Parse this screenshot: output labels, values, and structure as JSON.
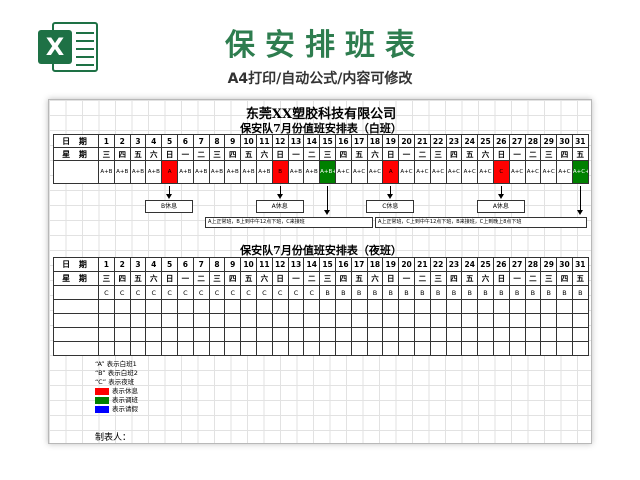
{
  "banner": {
    "title": "保安排班表",
    "subtitle": "A4打印/自动公式/内容可修改",
    "logo_icon": "excel-icon",
    "logo_letter": "X"
  },
  "sheet": {
    "company": "东莞XX塑胶科技有限公司",
    "day_title": "保安队7月份值班安排表（白班）",
    "night_title": "保安队7月份值班安排表（夜班）",
    "date_label": "日 期",
    "week_label": "星 期",
    "days": [
      "1",
      "2",
      "3",
      "4",
      "5",
      "6",
      "7",
      "8",
      "9",
      "10",
      "11",
      "12",
      "13",
      "14",
      "15",
      "16",
      "17",
      "18",
      "19",
      "20",
      "21",
      "22",
      "23",
      "24",
      "25",
      "26",
      "27",
      "28",
      "29",
      "30",
      "31"
    ],
    "weekdays": [
      "三",
      "四",
      "五",
      "六",
      "日",
      "一",
      "二",
      "三",
      "四",
      "五",
      "六",
      "日",
      "一",
      "二",
      "三",
      "四",
      "五",
      "六",
      "日",
      "一",
      "二",
      "三",
      "四",
      "五",
      "六",
      "日",
      "一",
      "二",
      "三",
      "四",
      "五"
    ],
    "day_shifts": [
      "A+B",
      "A+B",
      "A+B",
      "A+B",
      "A",
      "A+B",
      "A+B",
      "A+B",
      "A+B",
      "A+B",
      "A+B",
      "B",
      "A+B",
      "A+B",
      "A+B+C",
      "A+C",
      "A+C",
      "A+C",
      "A",
      "A+C",
      "A+C",
      "A+C",
      "A+C",
      "A+C",
      "A+C",
      "C",
      "A+C",
      "A+C",
      "A+C",
      "A+C",
      "A+C+B"
    ],
    "night_shifts": [
      "C",
      "C",
      "C",
      "C",
      "C",
      "C",
      "C",
      "C",
      "C",
      "C",
      "C",
      "C",
      "C",
      "C",
      "B",
      "B",
      "B",
      "B",
      "B",
      "B",
      "B",
      "B",
      "B",
      "B",
      "B",
      "B",
      "B",
      "B",
      "B",
      "B",
      "B"
    ],
    "rest_labels": [
      "B休息",
      "A休息",
      "C休息",
      "A休息"
    ],
    "notes": [
      "A上正常班，B上到中午12点下班，C来接班",
      "A上正常班，C上到中午12点下班，B来接班，C上到晚上8点下班"
    ],
    "note_b_evening": "B上到晚上8点下班",
    "legend": [
      {
        "text": "“A” 表示白班1"
      },
      {
        "text": "“B” 表示白班2"
      },
      {
        "text": "“C” 表示夜班"
      },
      {
        "text": "表示休息",
        "color": "#ff0000"
      },
      {
        "text": "表示调班",
        "color": "#008000"
      },
      {
        "text": "表示请假",
        "color": "#0000ff"
      }
    ],
    "maker_label": "制表人：",
    "colors": {
      "rest": "#ff0000",
      "swap": "#008000",
      "leave": "#0000ff",
      "brand": "#2e7d4f"
    },
    "highlight": {
      "rest_days": [
        "5",
        "12",
        "19",
        "26"
      ],
      "swap_days": [
        "15",
        "31"
      ]
    }
  }
}
